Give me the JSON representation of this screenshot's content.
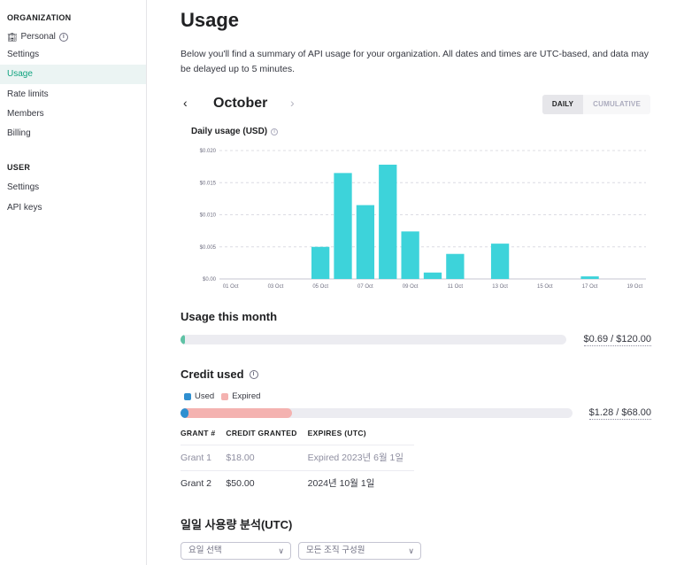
{
  "sidebar": {
    "org_heading": "ORGANIZATION",
    "org_items": [
      {
        "label": "Personal",
        "icon": "building-icon"
      },
      {
        "label": "Settings"
      },
      {
        "label": "Usage",
        "active": true
      },
      {
        "label": "Rate limits"
      },
      {
        "label": "Members"
      },
      {
        "label": "Billing"
      }
    ],
    "user_heading": "USER",
    "user_items": [
      {
        "label": "Settings"
      },
      {
        "label": "API keys"
      }
    ]
  },
  "header": {
    "title": "Usage",
    "description": "Below you'll find a summary of API usage for your organization. All dates and times are UTC-based, and data may be delayed up to 5 minutes."
  },
  "period": {
    "month": "October",
    "prev_icon": "chevron-left-icon",
    "next_icon": "chevron-right-icon",
    "toggle": [
      {
        "label": "DAILY",
        "active": true
      },
      {
        "label": "CUMULATIVE",
        "active": false
      }
    ]
  },
  "chart_title": "Daily usage (USD)",
  "chart_data": {
    "type": "bar",
    "title": "Daily usage (USD)",
    "x": [
      "01 Oct",
      "02 Oct",
      "03 Oct",
      "04 Oct",
      "05 Oct",
      "06 Oct",
      "07 Oct",
      "08 Oct",
      "09 Oct",
      "10 Oct",
      "11 Oct",
      "12 Oct",
      "13 Oct",
      "14 Oct",
      "15 Oct",
      "16 Oct",
      "17 Oct",
      "18 Oct",
      "19 Oct"
    ],
    "values": [
      0,
      0,
      0,
      0,
      0.005,
      0.0165,
      0.0115,
      0.0178,
      0.0074,
      0.001,
      0.0039,
      0,
      0.0055,
      0,
      0,
      0,
      0.0004,
      0,
      0
    ],
    "xticks": [
      "01 Oct",
      "03 Oct",
      "05 Oct",
      "07 Oct",
      "09 Oct",
      "11 Oct",
      "13 Oct",
      "15 Oct",
      "17 Oct",
      "19 Oct"
    ],
    "yticks": [
      "$0.00",
      "$0.005",
      "$0.010",
      "$0.015",
      "$0.020"
    ],
    "ylim": [
      0,
      0.02
    ],
    "color": "#3dd3da",
    "grid": true
  },
  "usage_month": {
    "title": "Usage this month",
    "amount": "$0.69 / $120.00",
    "fraction": 0.00575,
    "color": "#5fc2a5"
  },
  "credit": {
    "title": "Credit used",
    "legend": [
      {
        "label": "Used",
        "color": "#2f8fd0"
      },
      {
        "label": "Expired",
        "color": "#f4b2b0"
      }
    ],
    "used_fraction": 0.0188,
    "expired_fraction": 0.2647,
    "amount": "$1.28 / $68.00"
  },
  "grants": {
    "headers": [
      "GRANT #",
      "CREDIT GRANTED",
      "EXPIRES (UTC)"
    ],
    "rows": [
      {
        "grant": "Grant 1",
        "amount": "$18.00",
        "expires": "Expired 2023년 6월 1일",
        "expired": true
      },
      {
        "grant": "Grant 2",
        "amount": "$50.00",
        "expires": "2024년 10월 1일",
        "expired": false
      }
    ]
  },
  "daily_analysis": {
    "title": "일일 사용량 분석(UTC)",
    "day_select": "요일 선택",
    "member_select": "모든 조직 구성원"
  }
}
